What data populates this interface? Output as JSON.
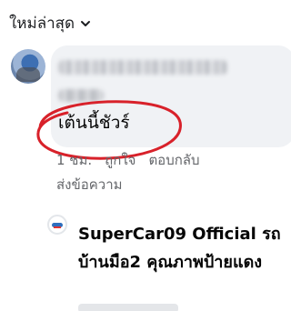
{
  "sort": {
    "label": "ใหม่ล่าสุด",
    "icon": "chevron-down-icon"
  },
  "comment": {
    "text": "เต้นนี้ชัวร์",
    "time": "1 ชม.",
    "like": "ถูกใจ",
    "reply": "ตอบกลับ",
    "message": "ส่งข้อความ",
    "annotation_color": "#d8212a"
  },
  "reply": {
    "author_text": "SuperCar09 Official รถบ้านมือ2 คุณภาพป้ายแดง"
  },
  "colors": {
    "bubble": "#f0f2f5",
    "meta": "#65676b",
    "text": "#050505"
  }
}
